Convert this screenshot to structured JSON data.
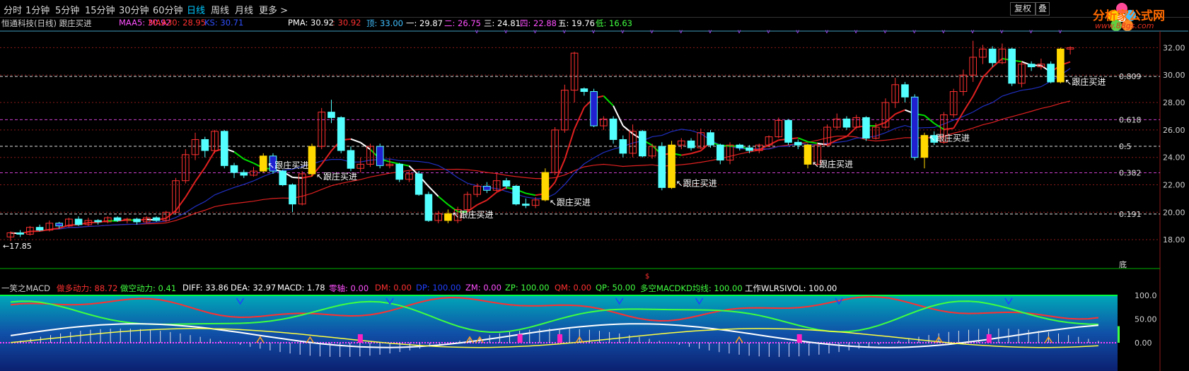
{
  "toolbar": {
    "periods": [
      "分时",
      "1分钟",
      "5分钟",
      "15分钟",
      "30分钟",
      "60分钟",
      "日线",
      "周线",
      "月线",
      "更多 >"
    ],
    "active_period": "日线",
    "fuquan_label": "复权",
    "overlay_label": "叠"
  },
  "logo": {
    "text": "分析家公式网",
    "url": "www.88gs.com"
  },
  "main_info": {
    "title": "恒通科技(日线) 跟庄买进",
    "maa5": "MAA5: 30.92",
    "maa30": "MAA30: 28.95",
    "ks": "KS: 30.71",
    "pma_label": "PMA: 30.92",
    "pma_value": ": 30.92",
    "top": "顶: 33.00",
    "l1": "一: 29.87",
    "l2": "二: 26.75",
    "l3": "三: 24.81",
    "l4": "四: 22.88",
    "l5": "五: 19.76",
    "low": "低: 16.63"
  },
  "price_axis": {
    "ticks": [
      "32.00",
      "30.00",
      "28.00",
      "26.00",
      "24.00",
      "22.00",
      "20.00",
      "18.00"
    ],
    "min": 16.0,
    "max": 33.0
  },
  "fib_levels": {
    "values": [
      29.9,
      26.75,
      24.81,
      22.88,
      19.87
    ],
    "labels": [
      "0.809",
      "0.618",
      "0.5",
      "0.382",
      "0.191"
    ]
  },
  "bottom_label": "底",
  "low_marker": "17.85",
  "buy_signal_label": "跟庄买进",
  "buy_signals": [
    {
      "bar": 26,
      "price": 23.2
    },
    {
      "bar": 31,
      "price": 22.4
    },
    {
      "bar": 45,
      "price": 19.6
    },
    {
      "bar": 55,
      "price": 20.5
    },
    {
      "bar": 68,
      "price": 21.9
    },
    {
      "bar": 82,
      "price": 23.3
    },
    {
      "bar": 94,
      "price": 25.2
    },
    {
      "bar": 108,
      "price": 29.3
    }
  ],
  "candles": [
    [
      18.2,
      18.5,
      17.9,
      18.6
    ],
    [
      18.5,
      18.4,
      18.2,
      18.7
    ],
    [
      18.4,
      18.9,
      18.3,
      19.0
    ],
    [
      18.9,
      18.7,
      18.6,
      19.1
    ],
    [
      18.7,
      19.2,
      18.6,
      19.4
    ],
    [
      19.2,
      19.0,
      18.8,
      19.3
    ],
    [
      19.0,
      19.5,
      18.9,
      19.6
    ],
    [
      19.5,
      19.1,
      19.0,
      19.7
    ],
    [
      19.1,
      19.4,
      19.0,
      19.6
    ],
    [
      19.4,
      19.3,
      19.1,
      19.5
    ],
    [
      19.3,
      19.6,
      19.2,
      19.7
    ],
    [
      19.6,
      19.4,
      19.3,
      19.7
    ],
    [
      19.4,
      19.5,
      19.2,
      19.6
    ],
    [
      19.5,
      19.3,
      19.1,
      19.6
    ],
    [
      19.3,
      19.6,
      19.2,
      19.7
    ],
    [
      19.6,
      19.4,
      19.3,
      19.7
    ],
    [
      19.4,
      20.0,
      19.3,
      20.1
    ],
    [
      20.0,
      22.3,
      19.9,
      22.5
    ],
    [
      22.3,
      24.2,
      22.1,
      24.6
    ],
    [
      24.2,
      25.3,
      23.8,
      25.8
    ],
    [
      25.3,
      24.5,
      24.0,
      25.5
    ],
    [
      24.5,
      25.9,
      24.3,
      26.0
    ],
    [
      25.9,
      23.4,
      23.2,
      26.0
    ],
    [
      23.4,
      22.9,
      22.5,
      23.6
    ],
    [
      22.9,
      22.7,
      22.5,
      23.1
    ],
    [
      22.7,
      23.0,
      22.6,
      23.3
    ],
    [
      23.0,
      24.1,
      22.9,
      24.3
    ],
    [
      24.1,
      23.0,
      22.8,
      24.3
    ],
    [
      23.0,
      22.0,
      21.9,
      23.1
    ],
    [
      22.0,
      20.6,
      20.0,
      22.1
    ],
    [
      20.6,
      22.8,
      20.5,
      23.0
    ],
    [
      22.8,
      24.8,
      22.6,
      25.0
    ],
    [
      24.8,
      27.3,
      24.6,
      27.6
    ],
    [
      27.3,
      26.9,
      26.5,
      28.2
    ],
    [
      26.9,
      24.5,
      24.3,
      27.0
    ],
    [
      24.5,
      23.2,
      23.0,
      24.8
    ],
    [
      23.2,
      23.5,
      22.9,
      24.0
    ],
    [
      23.5,
      24.8,
      23.3,
      25.0
    ],
    [
      24.8,
      23.4,
      23.2,
      25.0
    ],
    [
      23.4,
      23.5,
      23.2,
      23.9
    ],
    [
      23.5,
      22.4,
      22.2,
      23.6
    ],
    [
      22.4,
      22.8,
      22.2,
      23.0
    ],
    [
      22.8,
      21.3,
      21.2,
      23.0
    ],
    [
      21.3,
      19.4,
      19.3,
      21.5
    ],
    [
      19.4,
      19.9,
      19.2,
      20.1
    ],
    [
      19.9,
      19.4,
      19.2,
      20.2
    ],
    [
      19.4,
      20.2,
      19.2,
      20.4
    ],
    [
      20.2,
      21.3,
      20.0,
      21.5
    ],
    [
      21.3,
      21.9,
      21.1,
      22.1
    ],
    [
      21.9,
      21.6,
      21.4,
      22.2
    ],
    [
      21.6,
      22.3,
      21.5,
      22.8
    ],
    [
      22.3,
      21.9,
      21.7,
      22.5
    ],
    [
      21.9,
      20.6,
      20.5,
      22.0
    ],
    [
      20.6,
      20.5,
      20.3,
      21.0
    ],
    [
      20.5,
      20.9,
      20.3,
      21.1
    ],
    [
      20.9,
      22.9,
      20.8,
      23.2
    ],
    [
      22.9,
      26.0,
      22.7,
      26.2
    ],
    [
      26.0,
      28.9,
      25.8,
      29.3
    ],
    [
      28.9,
      31.6,
      28.0,
      31.7
    ],
    [
      29.0,
      28.8,
      28.5,
      29.1
    ],
    [
      28.8,
      26.3,
      26.2,
      29.0
    ],
    [
      26.3,
      26.8,
      26.0,
      27.0
    ],
    [
      26.8,
      25.3,
      25.0,
      27.0
    ],
    [
      25.3,
      24.3,
      24.0,
      25.6
    ],
    [
      24.3,
      25.9,
      24.0,
      26.4
    ],
    [
      25.9,
      24.1,
      24.0,
      26.0
    ],
    [
      24.1,
      24.8,
      23.9,
      25.0
    ],
    [
      24.8,
      21.8,
      21.6,
      25.1
    ],
    [
      21.8,
      24.9,
      21.7,
      25.2
    ],
    [
      24.9,
      25.2,
      24.6,
      25.4
    ],
    [
      25.2,
      24.7,
      24.5,
      25.4
    ],
    [
      24.7,
      25.8,
      24.6,
      26.1
    ],
    [
      25.8,
      24.9,
      24.7,
      26.0
    ],
    [
      24.9,
      23.8,
      23.5,
      25.0
    ],
    [
      23.8,
      24.9,
      23.5,
      25.1
    ],
    [
      24.9,
      24.7,
      24.5,
      25.0
    ],
    [
      24.7,
      24.5,
      24.3,
      24.9
    ],
    [
      24.5,
      24.9,
      24.3,
      25.0
    ],
    [
      24.9,
      25.5,
      24.8,
      25.6
    ],
    [
      25.5,
      26.7,
      25.4,
      26.9
    ],
    [
      26.7,
      25.1,
      24.9,
      26.8
    ],
    [
      25.1,
      24.9,
      24.6,
      25.3
    ],
    [
      24.9,
      23.5,
      23.2,
      25.0
    ],
    [
      23.5,
      24.9,
      23.4,
      25.1
    ],
    [
      24.9,
      26.2,
      24.8,
      26.4
    ],
    [
      26.2,
      26.8,
      26.0,
      27.2
    ],
    [
      26.8,
      26.2,
      26.0,
      27.0
    ],
    [
      26.2,
      26.9,
      26.1,
      27.1
    ],
    [
      26.9,
      25.4,
      25.2,
      27.0
    ],
    [
      25.4,
      26.2,
      25.3,
      26.5
    ],
    [
      26.2,
      28.0,
      26.1,
      28.3
    ],
    [
      28.0,
      29.3,
      27.6,
      29.8
    ],
    [
      29.3,
      28.4,
      28.0,
      29.5
    ],
    [
      28.4,
      24.0,
      23.8,
      28.6
    ],
    [
      24.0,
      25.6,
      23.2,
      25.8
    ],
    [
      25.6,
      25.1,
      24.9,
      25.9
    ],
    [
      25.1,
      27.1,
      25.0,
      27.3
    ],
    [
      27.1,
      28.8,
      26.9,
      29.0
    ],
    [
      28.8,
      30.0,
      28.5,
      30.4
    ],
    [
      30.0,
      31.3,
      29.5,
      32.5
    ],
    [
      31.3,
      31.9,
      30.8,
      32.2
    ],
    [
      31.9,
      30.9,
      30.6,
      32.1
    ],
    [
      30.9,
      31.9,
      30.8,
      32.3
    ],
    [
      31.9,
      29.4,
      29.2,
      32.0
    ],
    [
      29.4,
      30.8,
      29.1,
      31.0
    ],
    [
      30.8,
      30.6,
      30.3,
      31.0
    ],
    [
      30.6,
      30.8,
      30.4,
      31.2
    ],
    [
      30.8,
      29.5,
      29.4,
      31.0
    ],
    [
      29.5,
      31.9,
      29.4,
      32.0
    ],
    [
      31.9,
      32.0,
      31.5,
      32.1
    ]
  ],
  "sub_info": {
    "title": "一笑之MACD",
    "duo": "做多动力: 88.72",
    "kong": "做空动力: 0.41",
    "diff": "DIFF: 33.86",
    "dea": "DEA: 32.97",
    "macd": "MACD: 1.78",
    "zero": "零轴: 0.00",
    "dm": "DM: 0.00",
    "dp": "DP: 100.00",
    "zm": "ZM: 0.00",
    "zp": "ZP: 100.00",
    "qm": "QM: 0.00",
    "qp": "QP: 50.00",
    "dk": "多空MACDKD均线: 100.00",
    "wl": "工作WLRSIVOL: 100.00"
  },
  "sub_axis": {
    "ticks": [
      "100.0",
      "50.00",
      "0.00"
    ]
  },
  "colors": {
    "up": "#ff3030",
    "down_fill": "#54ffff",
    "buy_fill": "#ffd800",
    "blue_fill": "#2020d0",
    "fib_line": "#cc40cc",
    "grid": "#8b1a1a",
    "ma_short": "#ffffff",
    "ma_green": "#00e000",
    "ma_red": "#e02020",
    "ma_blue": "#2030c0"
  }
}
